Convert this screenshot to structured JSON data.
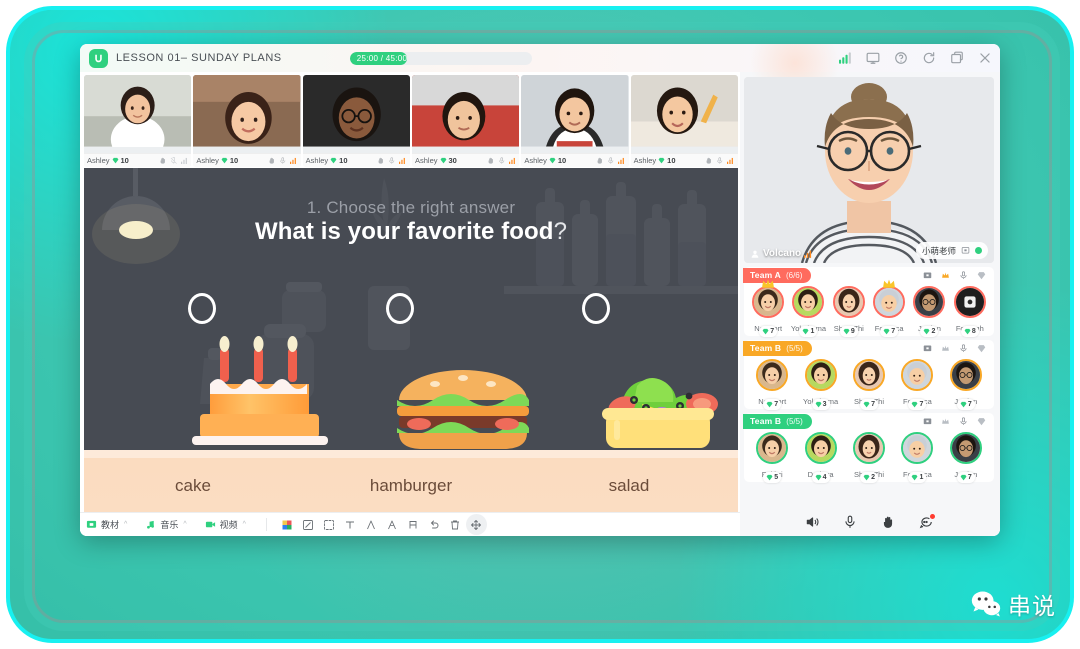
{
  "window": {
    "lesson_title": "LESSON 01– SUNDAY PLANS",
    "logo_icon": "app-logo-icon",
    "timer": {
      "text": "25:00 / 45:00",
      "elapsed": "25:00",
      "total": "45:00",
      "progress_pct": 31
    },
    "title_icons": [
      {
        "name": "signal-icon",
        "glyph": "signal"
      },
      {
        "name": "monitor-icon",
        "glyph": "monitor"
      },
      {
        "name": "help-icon",
        "glyph": "help"
      },
      {
        "name": "refresh-icon",
        "glyph": "refresh"
      },
      {
        "name": "window-icon",
        "glyph": "window"
      },
      {
        "name": "close-icon",
        "glyph": "close"
      }
    ]
  },
  "students": [
    {
      "name": "Ashley",
      "score": "10",
      "muted": true,
      "signal": "off"
    },
    {
      "name": "Ashley",
      "score": "10",
      "muted": false,
      "signal": "on"
    },
    {
      "name": "Ashley",
      "score": "10",
      "muted": false,
      "signal": "on"
    },
    {
      "name": "Ashley",
      "score": "30",
      "muted": false,
      "signal": "on"
    },
    {
      "name": "Ashley",
      "score": "10",
      "muted": false,
      "signal": "on"
    },
    {
      "name": "Ashley",
      "score": "10",
      "muted": false,
      "signal": "on"
    }
  ],
  "slide": {
    "question_number": "1. Choose the right answer",
    "question": "What is your favorite food",
    "question_mark": "?",
    "options": [
      {
        "label": "cake",
        "selected": false
      },
      {
        "label": "hamburger",
        "selected": false
      },
      {
        "label": "salad",
        "selected": false
      }
    ]
  },
  "toolbar": {
    "groups": [
      {
        "label": "教材",
        "icon": "materials-icon"
      },
      {
        "label": "音乐",
        "icon": "music-icon"
      },
      {
        "label": "视频",
        "icon": "video-icon"
      }
    ],
    "tools": [
      {
        "name": "color-picker-icon"
      },
      {
        "name": "stroke-width-icon"
      },
      {
        "name": "select-area-icon"
      },
      {
        "name": "text-tool-icon"
      },
      {
        "name": "pen-tool-icon"
      },
      {
        "name": "highlighter-tool-icon"
      },
      {
        "name": "eraser-tool-icon"
      },
      {
        "name": "undo-icon"
      },
      {
        "name": "delete-icon"
      },
      {
        "name": "move-icon"
      }
    ]
  },
  "teacher": {
    "stream_name": "Volcano",
    "badge_name": "小萌老师",
    "status": "online"
  },
  "teams": [
    {
      "name": "Team A",
      "count": "(6/6)",
      "color": "#ff6b5e",
      "members": [
        {
          "name": "Newport",
          "score": "7",
          "crown": true
        },
        {
          "name": "Yokohama",
          "score": "1",
          "crown": false
        },
        {
          "name": "Shen Zhi",
          "score": "9",
          "crown": false
        },
        {
          "name": "Fonseca",
          "score": "7",
          "crown": true
        },
        {
          "name": "Jordan",
          "score": "2",
          "crown": false
        },
        {
          "name": "Foroogh",
          "score": "8",
          "crown": false
        }
      ]
    },
    {
      "name": "Team B",
      "count": "(5/5)",
      "color": "#f9a game",
      "members": [
        {
          "name": "Newport",
          "score": "7",
          "crown": false
        },
        {
          "name": "Yokohama",
          "score": "3",
          "crown": false
        },
        {
          "name": "Shen Zhi",
          "score": "7",
          "crown": false
        },
        {
          "name": "Fonseca",
          "score": "7",
          "crown": false
        },
        {
          "name": "Jordan",
          "score": "7",
          "crown": false
        }
      ]
    },
    {
      "name": "Team B",
      "count": "(5/5)",
      "color": "#2fd07f",
      "members": [
        {
          "name": "Fakhri",
          "score": "5",
          "crown": false
        },
        {
          "name": "Dedova",
          "score": "4",
          "crown": false
        },
        {
          "name": "Shen Zhi",
          "score": "2",
          "crown": false
        },
        {
          "name": "Fonseca",
          "score": "1",
          "crown": false
        },
        {
          "name": "Jordan",
          "score": "7",
          "crown": false
        }
      ]
    }
  ],
  "team_head_icons": [
    {
      "name": "screen-share-icon"
    },
    {
      "name": "crown-icon"
    },
    {
      "name": "mic-icon"
    },
    {
      "name": "gem-icon"
    }
  ],
  "call_controls": [
    {
      "name": "speaker-icon",
      "badge": false
    },
    {
      "name": "microphone-icon",
      "badge": false
    },
    {
      "name": "raise-hand-icon",
      "badge": false
    },
    {
      "name": "chat-icon",
      "badge": true
    }
  ],
  "watermark": {
    "text": "串说",
    "icon": "wechat-icon"
  },
  "colors": {
    "brand_green": "#2fd07f",
    "team_a": "#ff6b5e",
    "team_b_orange": "#f9a826",
    "team_b_green": "#2fd07f",
    "frame_cyan": "#18f0f0",
    "frame_teal": "#3fc9b4",
    "slide_bg": "#474b53",
    "counter_bg": "#fbdcc0"
  }
}
